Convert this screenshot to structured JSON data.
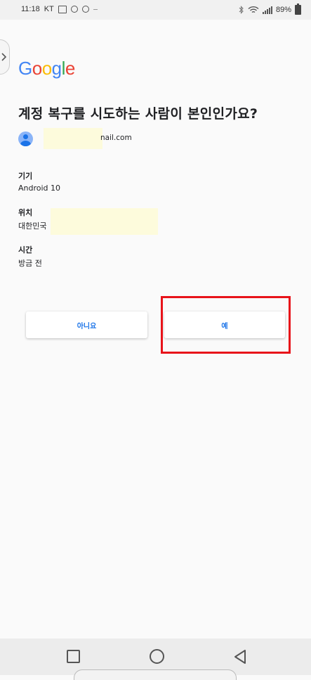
{
  "status_bar": {
    "time": "11:18",
    "carrier": "KT",
    "battery": "89%"
  },
  "logo": {
    "letters": [
      "G",
      "o",
      "o",
      "g",
      "l",
      "e"
    ]
  },
  "title": "계정 복구를 시도하는 사람이 본인인가요?",
  "account": {
    "email_suffix": "nail.com"
  },
  "details": {
    "device_label": "기기",
    "device_value": "Android 10",
    "location_label": "위치",
    "location_value": "대한민국",
    "time_label": "시간",
    "time_value": "방금 전"
  },
  "buttons": {
    "no_label": "아니요",
    "yes_label": "예"
  },
  "colors": {
    "accent": "#1a73e8",
    "highlight": "#e8131a"
  }
}
